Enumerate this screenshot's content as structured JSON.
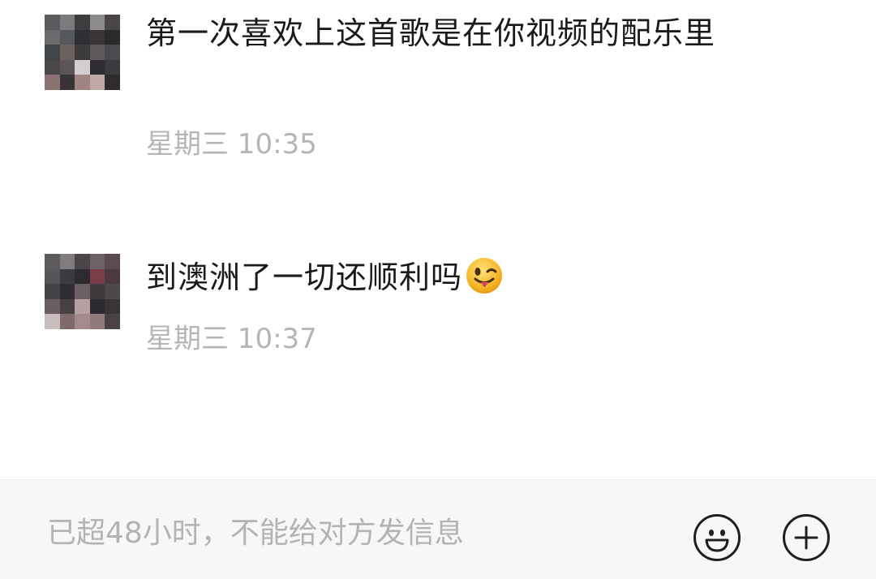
{
  "messages": [
    {
      "text": "第一次喜欢上这首歌是在你视频的配乐里",
      "time": "星期三 10:35"
    },
    {
      "text": "到澳洲了一切还顺利吗",
      "emoji": "winking-face-with-tongue-emoji",
      "time": "星期三 10:37"
    }
  ],
  "input_bar": {
    "notice": "已超48小时，不能给对方发信息",
    "emoji_icon": "smiley-face-icon",
    "add_icon": "plus-circle-icon"
  }
}
